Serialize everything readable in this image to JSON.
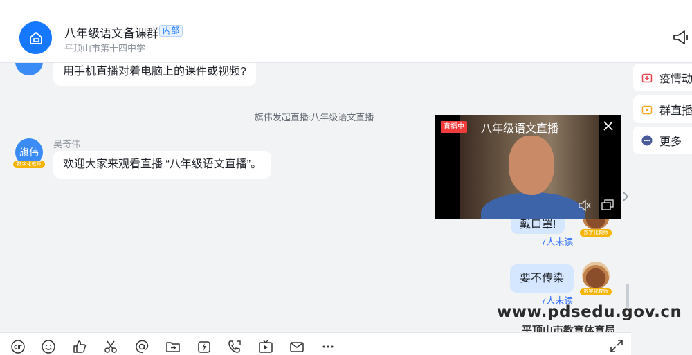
{
  "header": {
    "title": "八年级语文备课群",
    "badge": "内部",
    "subtitle": "平顶山市第十四中学"
  },
  "messages": {
    "question": "用手机直播对着电脑上的课件或视频?",
    "system_note": "旗伟发起直播:八年级语文直播",
    "sender_name": "吴奇伟",
    "sender_avatar": "旗伟",
    "sender_badge": "数字化教师",
    "sender_text": "欢迎大家来观看直播 “八年级语文直播”。",
    "self_partial_text": "戴口罩!",
    "self_text": "要不传染",
    "self_badge": "数字化教师",
    "unread_1": "7人未读",
    "unread_2": "7人未读"
  },
  "live": {
    "status": "直播中",
    "title": "八年级语文直播"
  },
  "side": {
    "item1": "疫情动态",
    "item2": "群直播",
    "item3": "更多"
  },
  "watermark": {
    "url": "www.pdsedu.gov.cn",
    "org": "平顶山市教育体育局"
  },
  "colors": {
    "accent": "#1677ff",
    "live_red": "#f23c3c",
    "self_bubble": "#d4e7ff"
  },
  "toolbar_icons": [
    "gif-icon",
    "emoji-icon",
    "thumbs-up-icon",
    "scissors-icon",
    "at-icon",
    "folder-send-icon",
    "lightning-icon",
    "phone-icon",
    "live-tv-icon",
    "mail-icon",
    "more-icon"
  ]
}
